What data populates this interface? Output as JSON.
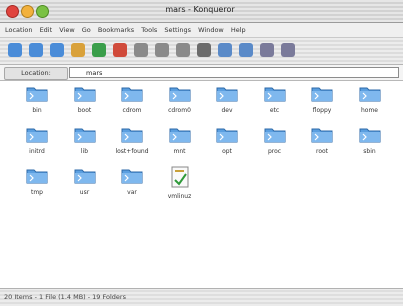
{
  "window": {
    "title": "mars - Konqueror"
  },
  "menu": [
    "Location",
    "Edit",
    "View",
    "Go",
    "Bookmarks",
    "Tools",
    "Settings",
    "Window",
    "Help"
  ],
  "toolbar_buttons": [
    {
      "name": "up-icon",
      "color": "#4a8cd8"
    },
    {
      "name": "back-icon",
      "color": "#4a8cd8"
    },
    {
      "name": "forward-icon",
      "color": "#4a8cd8"
    },
    {
      "name": "home-icon",
      "color": "#d9a13a"
    },
    {
      "name": "reload-icon",
      "color": "#3a9e4a"
    },
    {
      "name": "stop-icon",
      "color": "#d04a3a"
    },
    {
      "name": "cut-icon",
      "color": "#8a8a8a"
    },
    {
      "name": "copy-icon",
      "color": "#8a8a8a"
    },
    {
      "name": "paste-icon",
      "color": "#8a8a8a"
    },
    {
      "name": "print-icon",
      "color": "#6c6c6c"
    },
    {
      "name": "zoom-in-icon",
      "color": "#5a8ac8"
    },
    {
      "name": "zoom-out-icon",
      "color": "#5a8ac8"
    },
    {
      "name": "icon-view-icon",
      "color": "#7a7a9a"
    },
    {
      "name": "list-view-icon",
      "color": "#7a7a9a"
    }
  ],
  "address": {
    "label": "Location:",
    "value": "mars"
  },
  "files": [
    {
      "name": "bin",
      "type": "folder"
    },
    {
      "name": "boot",
      "type": "folder"
    },
    {
      "name": "cdrom",
      "type": "folder"
    },
    {
      "name": "cdrom0",
      "type": "folder"
    },
    {
      "name": "dev",
      "type": "folder"
    },
    {
      "name": "etc",
      "type": "folder"
    },
    {
      "name": "floppy",
      "type": "folder"
    },
    {
      "name": "home",
      "type": "folder"
    },
    {
      "name": "initrd",
      "type": "folder"
    },
    {
      "name": "lib",
      "type": "folder"
    },
    {
      "name": "lost+found",
      "type": "folder"
    },
    {
      "name": "mnt",
      "type": "folder"
    },
    {
      "name": "opt",
      "type": "folder"
    },
    {
      "name": "proc",
      "type": "folder"
    },
    {
      "name": "root",
      "type": "folder"
    },
    {
      "name": "sbin",
      "type": "folder"
    },
    {
      "name": "tmp",
      "type": "folder"
    },
    {
      "name": "usr",
      "type": "folder"
    },
    {
      "name": "var",
      "type": "folder"
    },
    {
      "name": "vmlinuz",
      "type": "file"
    }
  ],
  "status": "20 Items - 1 File (1.4 MB) - 19 Folders"
}
